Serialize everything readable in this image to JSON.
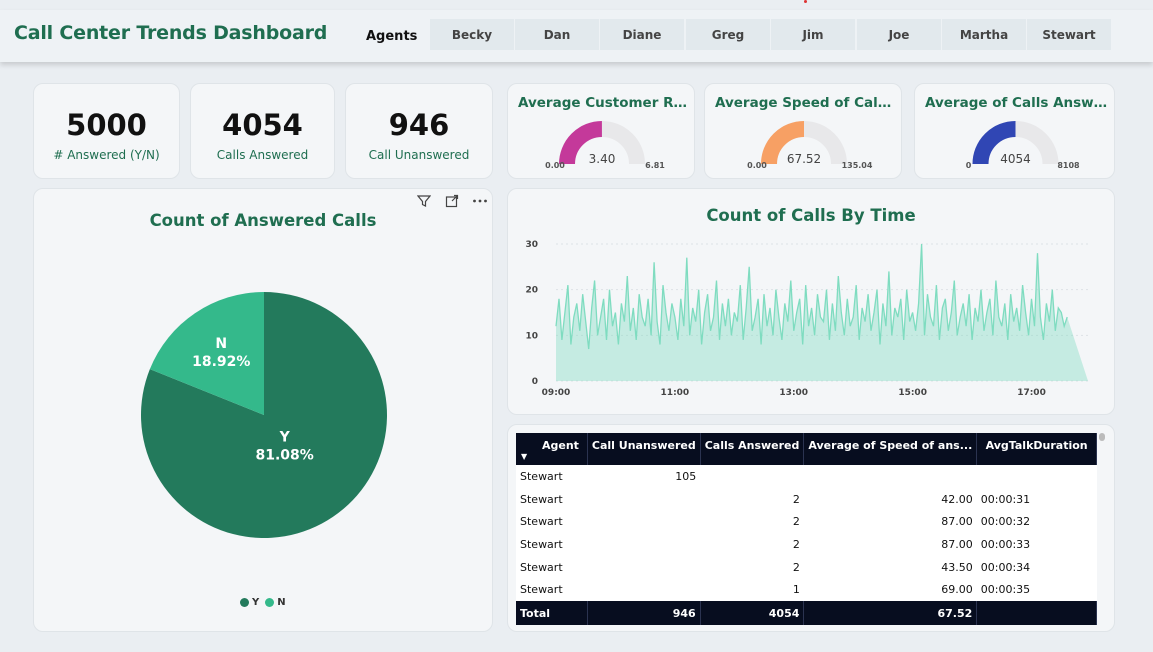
{
  "header": {
    "title": "Call Center Trends Dashboard",
    "agents_label": "Agents",
    "agents": [
      "Becky",
      "Dan",
      "Diane",
      "Greg",
      "Jim",
      "Joe",
      "Martha",
      "Stewart"
    ]
  },
  "kpis": [
    {
      "value": "5000",
      "label": "# Answered (Y/N)"
    },
    {
      "value": "4054",
      "label": "Calls Answered"
    },
    {
      "value": "946",
      "label": "Call Unanswered"
    }
  ],
  "gauges": [
    {
      "title": "Average Customer Rati...",
      "min": "0.00",
      "max": "6.81",
      "value_label": "3.40",
      "value": 3.4,
      "max_value": 6.81,
      "color": "#c4399a"
    },
    {
      "title": "Average Speed of Call A...",
      "min": "0.00",
      "max": "135.04",
      "value_label": "67.52",
      "value": 67.52,
      "max_value": 135.04,
      "color": "#f7a064"
    },
    {
      "title": "Average of Calls Answered",
      "min": "0",
      "max": "8108",
      "value_label": "4054",
      "value": 4054,
      "max_value": 8108,
      "color": "#3046b4"
    }
  ],
  "pie": {
    "title": "Count of Answered Calls",
    "legend": [
      {
        "label": "Y",
        "color": "#237a5c"
      },
      {
        "label": "N",
        "color": "#34b98b"
      }
    ]
  },
  "chart_data": [
    {
      "type": "pie",
      "title": "Count of Answered Calls",
      "labels": [
        "Y",
        "N"
      ],
      "values": [
        81.08,
        18.92
      ],
      "display_labels": [
        "81.08%",
        "18.92%"
      ],
      "colors": [
        "#237a5c",
        "#34b98b"
      ]
    },
    {
      "type": "area",
      "title": "Count of Calls By Time",
      "color": "#7fdcc0",
      "x_ticks": [
        "09:00",
        "11:00",
        "13:00",
        "15:00",
        "17:00"
      ],
      "y_ticks": [
        "0",
        "10",
        "20",
        "30"
      ],
      "ylim": [
        0,
        30
      ],
      "x": [
        "09:00",
        "09:03",
        "09:06",
        "09:09",
        "09:12",
        "09:15",
        "09:18",
        "09:21",
        "09:24",
        "09:27",
        "09:30",
        "09:33",
        "09:36",
        "09:39",
        "09:42",
        "09:45",
        "09:48",
        "09:51",
        "09:54",
        "09:57",
        "10:00",
        "10:03",
        "10:06",
        "10:09",
        "10:12",
        "10:15",
        "10:18",
        "10:21",
        "10:24",
        "10:27",
        "10:30",
        "10:33",
        "10:36",
        "10:39",
        "10:42",
        "10:45",
        "10:48",
        "10:51",
        "10:54",
        "10:57",
        "11:00",
        "11:03",
        "11:06",
        "11:09",
        "11:12",
        "11:15",
        "11:18",
        "11:21",
        "11:24",
        "11:27",
        "11:30",
        "11:33",
        "11:36",
        "11:39",
        "11:42",
        "11:45",
        "11:48",
        "11:51",
        "11:54",
        "11:57",
        "12:00",
        "12:03",
        "12:06",
        "12:09",
        "12:12",
        "12:15",
        "12:18",
        "12:21",
        "12:24",
        "12:27",
        "12:30",
        "12:33",
        "12:36",
        "12:39",
        "12:42",
        "12:45",
        "12:48",
        "12:51",
        "12:54",
        "12:57",
        "13:00",
        "13:03",
        "13:06",
        "13:09",
        "13:12",
        "13:15",
        "13:18",
        "13:21",
        "13:24",
        "13:27",
        "13:30",
        "13:33",
        "13:36",
        "13:39",
        "13:42",
        "13:45",
        "13:48",
        "13:51",
        "13:54",
        "13:57",
        "14:00",
        "14:03",
        "14:06",
        "14:09",
        "14:12",
        "14:15",
        "14:18",
        "14:21",
        "14:24",
        "14:27",
        "14:30",
        "14:33",
        "14:36",
        "14:39",
        "14:42",
        "14:45",
        "14:48",
        "14:51",
        "14:54",
        "14:57",
        "15:00",
        "15:03",
        "15:06",
        "15:09",
        "15:12",
        "15:15",
        "15:18",
        "15:21",
        "15:24",
        "15:27",
        "15:30",
        "15:33",
        "15:36",
        "15:39",
        "15:42",
        "15:45",
        "15:48",
        "15:51",
        "15:54",
        "15:57",
        "16:00",
        "16:03",
        "16:06",
        "16:09",
        "16:12",
        "16:15",
        "16:18",
        "16:21",
        "16:24",
        "16:27",
        "16:30",
        "16:33",
        "16:36",
        "16:39",
        "16:42",
        "16:45",
        "16:48",
        "16:51",
        "16:54",
        "16:57",
        "17:00",
        "17:03",
        "17:06",
        "17:09",
        "17:12",
        "17:15",
        "17:18",
        "17:21",
        "17:24",
        "17:27",
        "17:30",
        "17:33",
        "17:36",
        "17:39",
        "17:42",
        "17:45",
        "17:48",
        "17:51",
        "17:54",
        "17:57"
      ],
      "values": [
        12,
        18,
        9,
        15,
        21,
        8,
        14,
        17,
        11,
        19,
        13,
        7,
        16,
        22,
        10,
        14,
        18,
        9,
        20,
        12,
        15,
        8,
        17,
        13,
        23,
        11,
        16,
        9,
        19,
        14,
        12,
        18,
        10,
        26,
        13,
        8,
        21,
        15,
        11,
        17,
        14,
        9,
        18,
        12,
        27,
        10,
        16,
        13,
        20,
        8,
        15,
        19,
        11,
        14,
        22,
        9,
        17,
        12,
        18,
        10,
        15,
        13,
        21,
        9,
        16,
        25,
        11,
        14,
        18,
        8,
        19,
        12,
        16,
        10,
        20,
        14,
        9,
        17,
        13,
        22,
        11,
        15,
        18,
        8,
        21,
        12,
        16,
        10,
        19,
        14,
        13,
        20,
        9,
        17,
        11,
        23,
        15,
        10,
        18,
        12,
        14,
        21,
        9,
        16,
        13,
        19,
        11,
        15,
        20,
        8,
        17,
        12,
        24,
        10,
        16,
        14,
        18,
        9,
        20,
        13,
        15,
        11,
        17,
        30,
        10,
        19,
        14,
        12,
        21,
        9,
        16,
        18,
        11,
        15,
        22,
        10,
        14,
        17,
        12,
        19,
        9,
        16,
        13,
        20,
        11,
        15,
        18,
        10,
        22,
        14,
        12,
        17,
        9,
        19,
        13,
        16,
        11,
        21,
        15,
        10,
        18,
        12,
        28,
        14,
        9,
        17,
        13,
        20,
        11,
        16,
        15,
        12,
        14
      ]
    }
  ],
  "line": {
    "title": "Count of Calls By Time"
  },
  "table": {
    "columns": [
      "Agent",
      "Call Unanswered",
      "Calls Answered",
      "Average of Speed of ans...",
      "AvgTalkDuration"
    ],
    "rows": [
      [
        "Stewart",
        "105",
        "",
        "",
        ""
      ],
      [
        "Stewart",
        "",
        "2",
        "42.00",
        "00:00:31"
      ],
      [
        "Stewart",
        "",
        "2",
        "87.00",
        "00:00:32"
      ],
      [
        "Stewart",
        "",
        "2",
        "87.00",
        "00:00:33"
      ],
      [
        "Stewart",
        "",
        "2",
        "43.50",
        "00:00:34"
      ],
      [
        "Stewart",
        "",
        "1",
        "69.00",
        "00:00:35"
      ]
    ],
    "total": [
      "Total",
      "946",
      "4054",
      "67.52",
      ""
    ]
  }
}
